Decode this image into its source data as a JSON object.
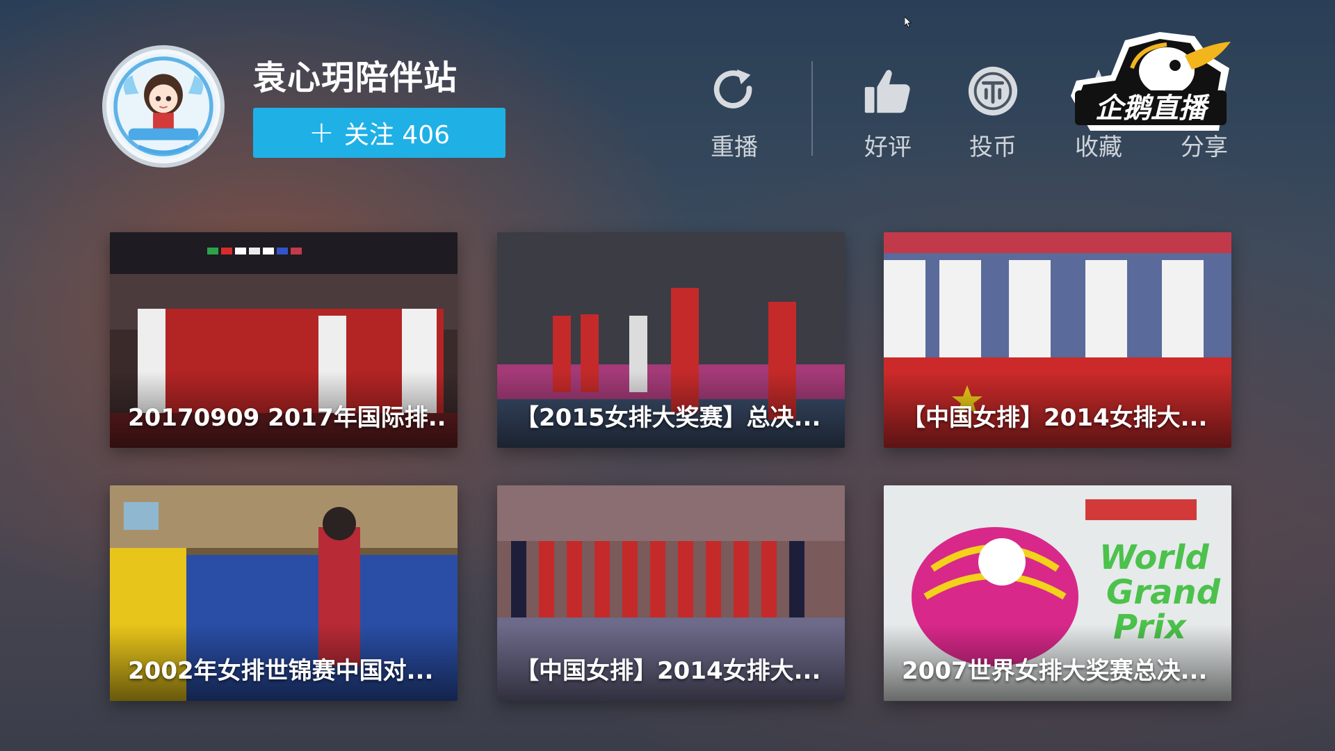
{
  "channel": {
    "name": "袁心玥陪伴站",
    "follow_label": "关注 406",
    "follow_icon": "plus-icon"
  },
  "actions": [
    {
      "label": "重播",
      "icon": "replay-icon"
    },
    {
      "label": "好评",
      "icon": "thumbs-up-icon"
    },
    {
      "label": "投币",
      "icon": "coin-icon"
    },
    {
      "label": "收藏",
      "icon": "favorite-icon"
    },
    {
      "label": "分享",
      "icon": "share-icon"
    }
  ],
  "logo": {
    "text": "企鹅直播"
  },
  "videos": [
    {
      "title": "20170909 2017年国际排..."
    },
    {
      "title": "【2015女排大奖赛】总决..."
    },
    {
      "title": "【中国女排】2014女排大..."
    },
    {
      "title": "2002年女排世锦赛中国对..."
    },
    {
      "title": "【中国女排】2014女排大..."
    },
    {
      "title": "2007世界女排大奖赛总决..."
    }
  ],
  "colors": {
    "accent": "#1fb0e6",
    "label": "#cfd4da"
  }
}
